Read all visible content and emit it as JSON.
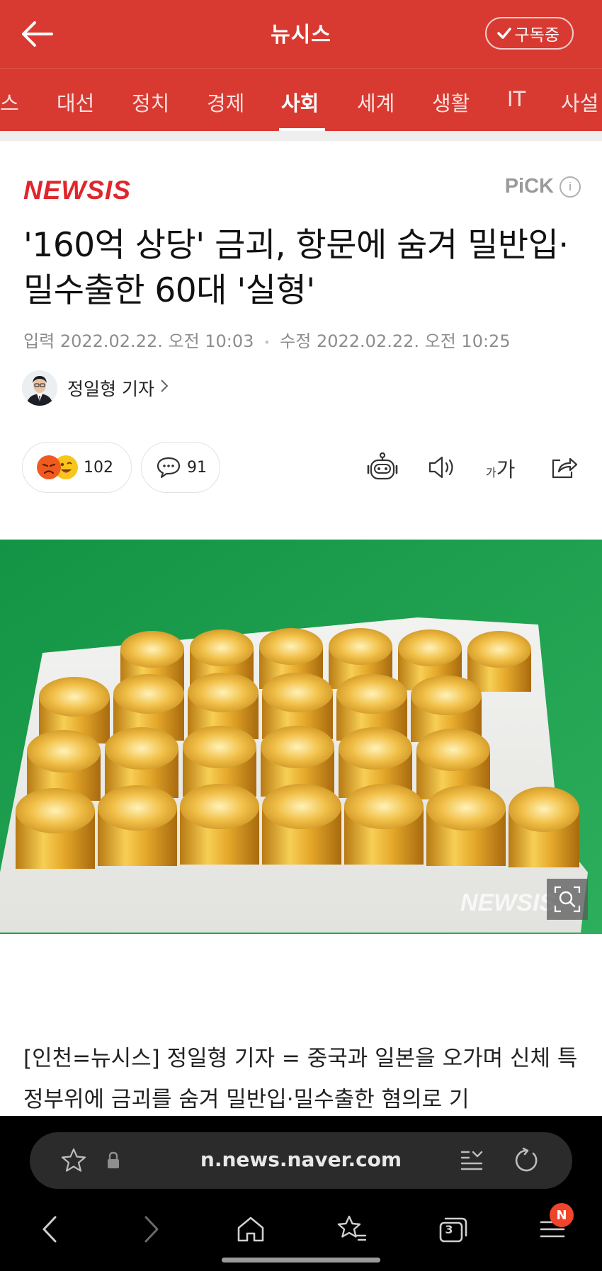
{
  "header": {
    "title": "뉴시스",
    "subscribe_label": "구독중"
  },
  "tabs": [
    {
      "label": "스",
      "active": false
    },
    {
      "label": "대선",
      "active": false
    },
    {
      "label": "정치",
      "active": false
    },
    {
      "label": "경제",
      "active": false
    },
    {
      "label": "사회",
      "active": true
    },
    {
      "label": "세계",
      "active": false
    },
    {
      "label": "생활",
      "active": false
    },
    {
      "label": "IT",
      "active": false
    },
    {
      "label": "사설",
      "active": false
    }
  ],
  "article": {
    "press_logo": "NEWSIS",
    "pick_label": "PiCK",
    "pick_info": "i",
    "headline": "'160억 상당' 금괴, 항문에 숨겨 밀반입·밀수출한 60대 '실형'",
    "input_label": "입력",
    "input_date": "2022.02.22. 오전 10:03",
    "modified_label": "수정",
    "modified_date": "2022.02.22. 오전 10:25",
    "reporter": "정일형 기자",
    "reactions_count": "102",
    "comments_count": "91",
    "font_small": "가",
    "font_big": "가",
    "photo_watermark": "NEWSIS",
    "body": "[인천=뉴시스] 정일형 기자 = 중국과 일본을 오가며 신체 특정부위에 금괴를 숨겨 밀반입·밀수출한 혐의로 기"
  },
  "browser": {
    "url": "n.news.naver.com",
    "tab_badge": "N",
    "tab_count": "3"
  },
  "colors": {
    "brand_red": "#d83a31",
    "logo_red": "#e0262c"
  }
}
